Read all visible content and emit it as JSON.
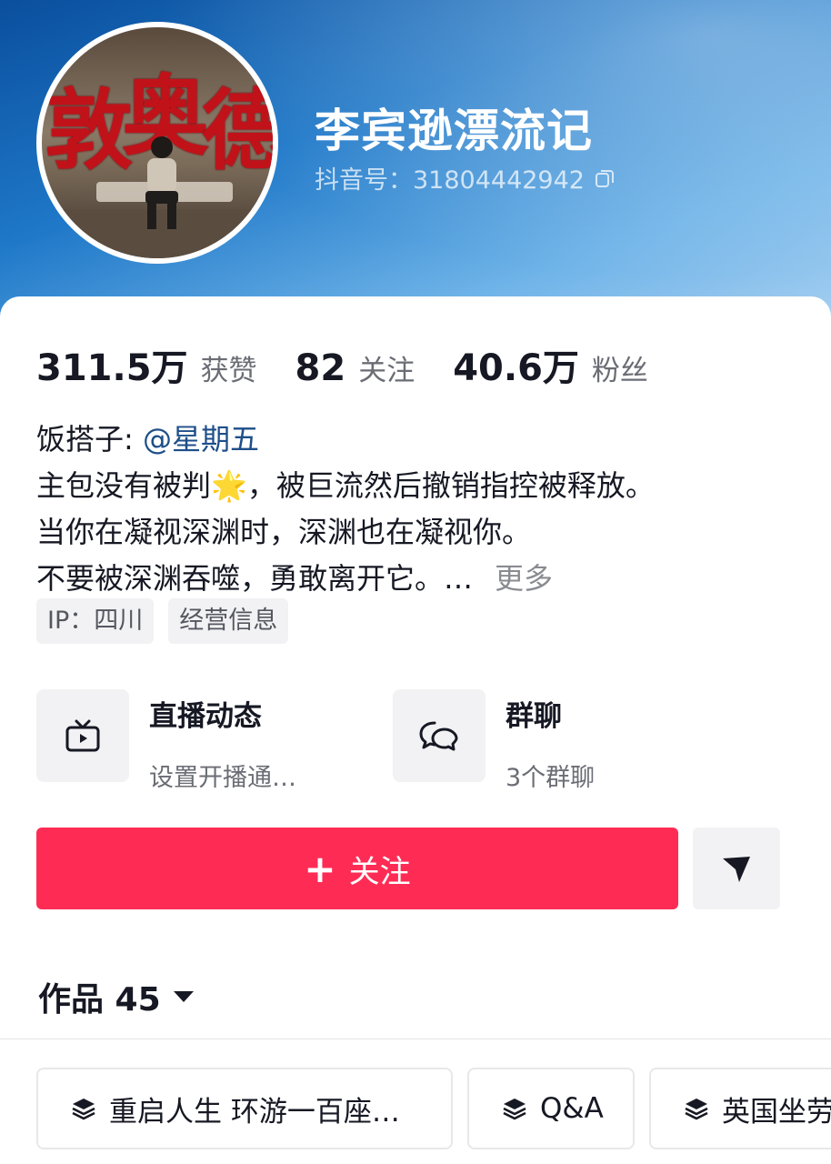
{
  "profile": {
    "nickname": "李宾逊漂流记",
    "douyin_id": "抖音号：31804442942",
    "avatar_text": [
      "敦",
      "奥",
      "德"
    ]
  },
  "stats": [
    {
      "value": "311.5万",
      "label": "获赞"
    },
    {
      "value": "82",
      "label": "关注"
    },
    {
      "value": "40.6万",
      "label": "粉丝"
    }
  ],
  "bio": {
    "partner_prefix": "饭搭子: ",
    "partner_mention": "@星期五",
    "line2_a": "主包没有被判",
    "line2_emoji": "🌟",
    "line2_b": "，被巨流然后撤销指控被释放。",
    "line3": "当你在凝视深渊时，深渊也在凝视你。",
    "line4": "不要被深渊吞噬，勇敢离开它。…",
    "more": "更多"
  },
  "chips": [
    "IP：四川",
    "经营信息"
  ],
  "features": [
    {
      "title": "直播动态",
      "subtitle": "设置开播通…",
      "icon": "tv-icon"
    },
    {
      "title": "群聊",
      "subtitle": "3个群聊",
      "icon": "chat-bubbles-icon"
    }
  ],
  "actions": {
    "follow_plus": "+",
    "follow_label": "关注",
    "share_icon": "send-icon"
  },
  "works": {
    "label": "作品 45"
  },
  "collections": [
    {
      "label": "重启人生 环游一百座…",
      "icon": "layers-icon"
    },
    {
      "label": "Q&A",
      "icon": "layers-icon"
    },
    {
      "label": "英国坐劳",
      "icon": "layers-icon"
    }
  ],
  "colors": {
    "follow_button": "#fe2c55",
    "mention": "#1d4e89",
    "header_gradient": [
      "#0a4f9e",
      "#6eb3e8"
    ]
  }
}
